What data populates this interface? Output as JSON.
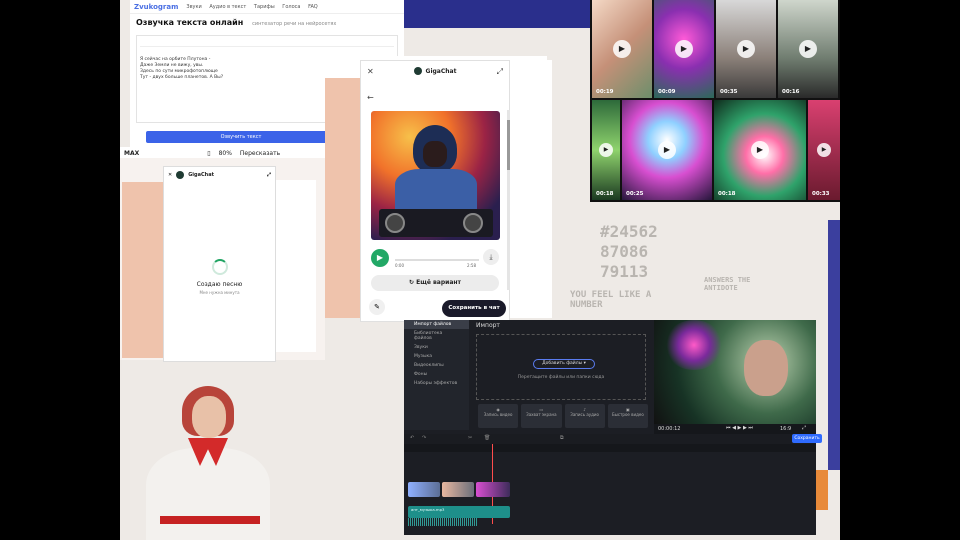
{
  "zvukogram": {
    "logo": "Zvukogram",
    "nav": [
      "Звуки",
      "Аудио в текст",
      "Тарифы",
      "Голоса",
      "FAQ"
    ],
    "title": "Озвучка текста онлайн",
    "subtitle": "синтезатор речи на нейросетях",
    "lyrics": [
      "Я сейчас на орбите Плутона -",
      "Даже Земли не вижу, увы.",
      "Здесь по сути микрофотоплюще",
      "Тут - двух больше планетов. А Вы?"
    ],
    "button": "Озвучить текст"
  },
  "maxbar": {
    "brand": "MAX",
    "zoom": "80%",
    "retell": "Пересказать"
  },
  "gigachat_left": {
    "name": "GigaChat",
    "status": "Создаю песню",
    "sub": "Мне нужна минута"
  },
  "gigachat_center": {
    "name": "GigaChat",
    "time_start": "0:00",
    "time_end": "2:58",
    "again_label": "Ещё вариант",
    "save_label": "Сохранить в чат"
  },
  "thumbnails": [
    {
      "duration": "00:19"
    },
    {
      "duration": "00:09"
    },
    {
      "duration": "00:35"
    },
    {
      "duration": "00:16"
    },
    {
      "duration": "00:18"
    },
    {
      "duration": "00:25"
    },
    {
      "duration": "00:18"
    },
    {
      "duration": "00:33"
    }
  ],
  "editor": {
    "sidebar": [
      "Импорт файлов",
      "Библиотека файлов",
      "Звуки",
      "Музыка",
      "Видеоклипы",
      "Фоны",
      "Наборы эффектов"
    ],
    "import_title": "Импорт",
    "add_files": "Добавить файлы",
    "drop_hint": "Перетащите файлы или папки сюда",
    "actions": [
      "Запись видео",
      "Захват экрана",
      "Запись аудио",
      "Быстрое видео"
    ],
    "timecode": "00:00:12",
    "aspect": "16:9",
    "export": "Сохранить",
    "audio_clip": "ант_музыка.mp3"
  },
  "doodles": {
    "numbers": "#24562 87086 79113",
    "side_text": "YOU FEEL LIKE A NUMBER",
    "answer": "ANSWERS THE ANTIDOTE"
  }
}
